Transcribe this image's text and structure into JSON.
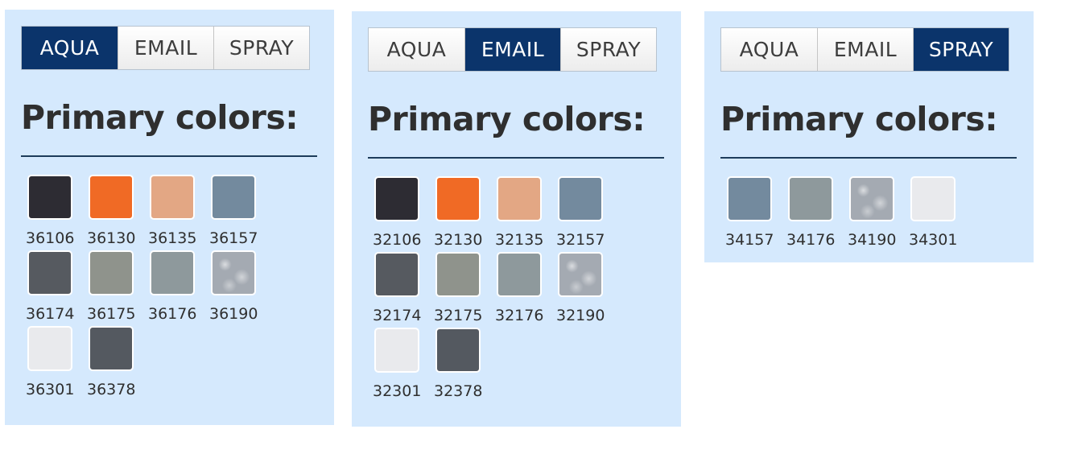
{
  "panels": [
    {
      "active_tab": 0,
      "tabs": [
        "AQUA",
        "EMAIL",
        "SPRAY"
      ],
      "heading": "Primary colors:",
      "swatches": [
        {
          "code": "36106",
          "color": "#2d2c33"
        },
        {
          "code": "36130",
          "color": "#f06a25"
        },
        {
          "code": "36135",
          "color": "#e3a784"
        },
        {
          "code": "36157",
          "color": "#738a9e"
        },
        {
          "code": "36174",
          "color": "#565a60"
        },
        {
          "code": "36175",
          "color": "#8f938c"
        },
        {
          "code": "36176",
          "color": "#8e999c"
        },
        {
          "code": "36190",
          "color": "#a4aab2",
          "metallic": true
        },
        {
          "code": "36301",
          "color": "#e9eaed"
        },
        {
          "code": "36378",
          "color": "#545960"
        }
      ]
    },
    {
      "active_tab": 1,
      "tabs": [
        "AQUA",
        "EMAIL",
        "SPRAY"
      ],
      "heading": "Primary colors:",
      "swatches": [
        {
          "code": "32106",
          "color": "#2d2c33"
        },
        {
          "code": "32130",
          "color": "#f06a25"
        },
        {
          "code": "32135",
          "color": "#e3a784"
        },
        {
          "code": "32157",
          "color": "#738a9e"
        },
        {
          "code": "32174",
          "color": "#565a60"
        },
        {
          "code": "32175",
          "color": "#8f938c"
        },
        {
          "code": "32176",
          "color": "#8e999c"
        },
        {
          "code": "32190",
          "color": "#a4aab2",
          "metallic": true
        },
        {
          "code": "32301",
          "color": "#e9eaed"
        },
        {
          "code": "32378",
          "color": "#545960"
        }
      ]
    },
    {
      "active_tab": 2,
      "tabs": [
        "AQUA",
        "EMAIL",
        "SPRAY"
      ],
      "heading": "Primary colors:",
      "swatches": [
        {
          "code": "34157",
          "color": "#738a9e"
        },
        {
          "code": "34176",
          "color": "#8e999c"
        },
        {
          "code": "34190",
          "color": "#a4aab2",
          "metallic": true
        },
        {
          "code": "34301",
          "color": "#e9eaed"
        }
      ]
    }
  ]
}
